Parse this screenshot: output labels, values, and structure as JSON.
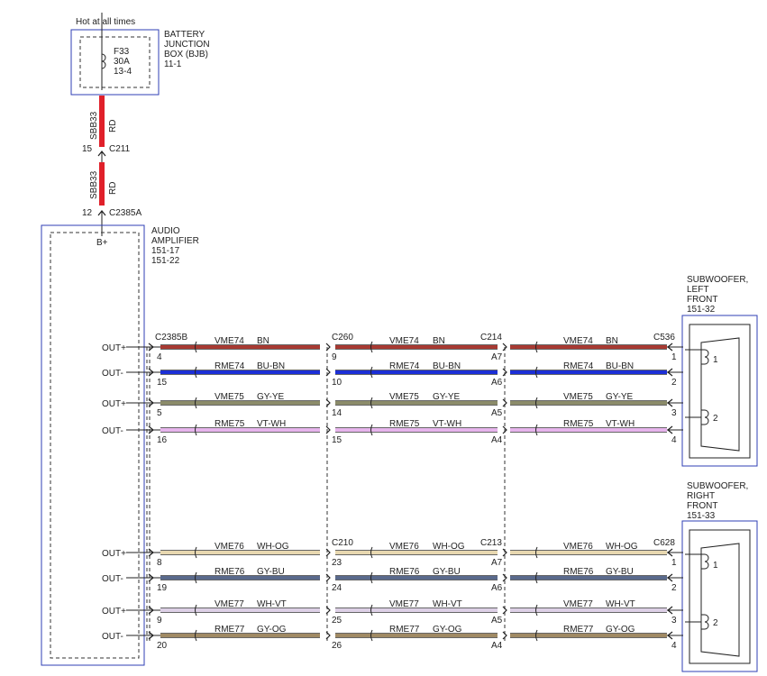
{
  "top_label": "Hot at all times",
  "bjb": {
    "title": [
      "BATTERY",
      "JUNCTION",
      "BOX (BJB)",
      "11-1"
    ],
    "fuse": [
      "F33",
      "30A",
      "13-4"
    ]
  },
  "wire_top": {
    "circuit": "SBB33",
    "color_code": "RD",
    "color": "#e0202a",
    "pin": "15",
    "connector": "C211"
  },
  "wire_mid": {
    "circuit": "SBB33",
    "color_code": "RD",
    "color": "#e0202a",
    "pin": "12",
    "connector": "C2385A"
  },
  "amp": {
    "title": [
      "AUDIO",
      "AMPLIFIER",
      "151-17",
      "151-22"
    ],
    "bplus": "B+"
  },
  "sub_left": {
    "title": [
      "SUBWOOFER,",
      "LEFT",
      "FRONT",
      "151-32"
    ],
    "pins": [
      "1",
      "2"
    ]
  },
  "sub_right": {
    "title": [
      "SUBWOOFER,",
      "RIGHT",
      "FRONT",
      "151-33"
    ],
    "pins": [
      "1",
      "2"
    ]
  },
  "groups": [
    {
      "connectors": [
        "C2385B",
        "C260",
        "C214",
        "C536"
      ],
      "wires": [
        {
          "out": "OUT+",
          "circuit": "VME74",
          "code": "BN",
          "color": "#a83a32",
          "pins": [
            "4",
            "9",
            "A7",
            "1"
          ]
        },
        {
          "out": "OUT-",
          "circuit": "RME74",
          "code": "BU-BN",
          "color": "#1c2fd6",
          "pins": [
            "15",
            "10",
            "A6",
            "2"
          ]
        },
        {
          "out": "OUT+",
          "circuit": "VME75",
          "code": "GY-YE",
          "color": "#8c8c6a",
          "pins": [
            "5",
            "14",
            "A5",
            "3"
          ]
        },
        {
          "out": "OUT-",
          "circuit": "RME75",
          "code": "VT-WH",
          "color": "#e6b4ec",
          "pins": [
            "16",
            "15",
            "A4",
            "4"
          ]
        }
      ]
    },
    {
      "connectors": [
        "",
        "C210",
        "C213",
        "C628"
      ],
      "wires": [
        {
          "out": "OUT+",
          "circuit": "VME76",
          "code": "WH-OG",
          "color": "#e8d8b0",
          "pins": [
            "8",
            "23",
            "A7",
            "1"
          ]
        },
        {
          "out": "OUT-",
          "circuit": "RME76",
          "code": "GY-BU",
          "color": "#5a6a8c",
          "pins": [
            "19",
            "24",
            "A6",
            "2"
          ]
        },
        {
          "out": "OUT+",
          "circuit": "VME77",
          "code": "WH-VT",
          "color": "#ddd0e6",
          "pins": [
            "9",
            "25",
            "A5",
            "3"
          ]
        },
        {
          "out": "OUT-",
          "circuit": "RME77",
          "code": "GY-OG",
          "color": "#a08a64",
          "pins": [
            "20",
            "26",
            "A4",
            "4"
          ]
        }
      ]
    }
  ]
}
